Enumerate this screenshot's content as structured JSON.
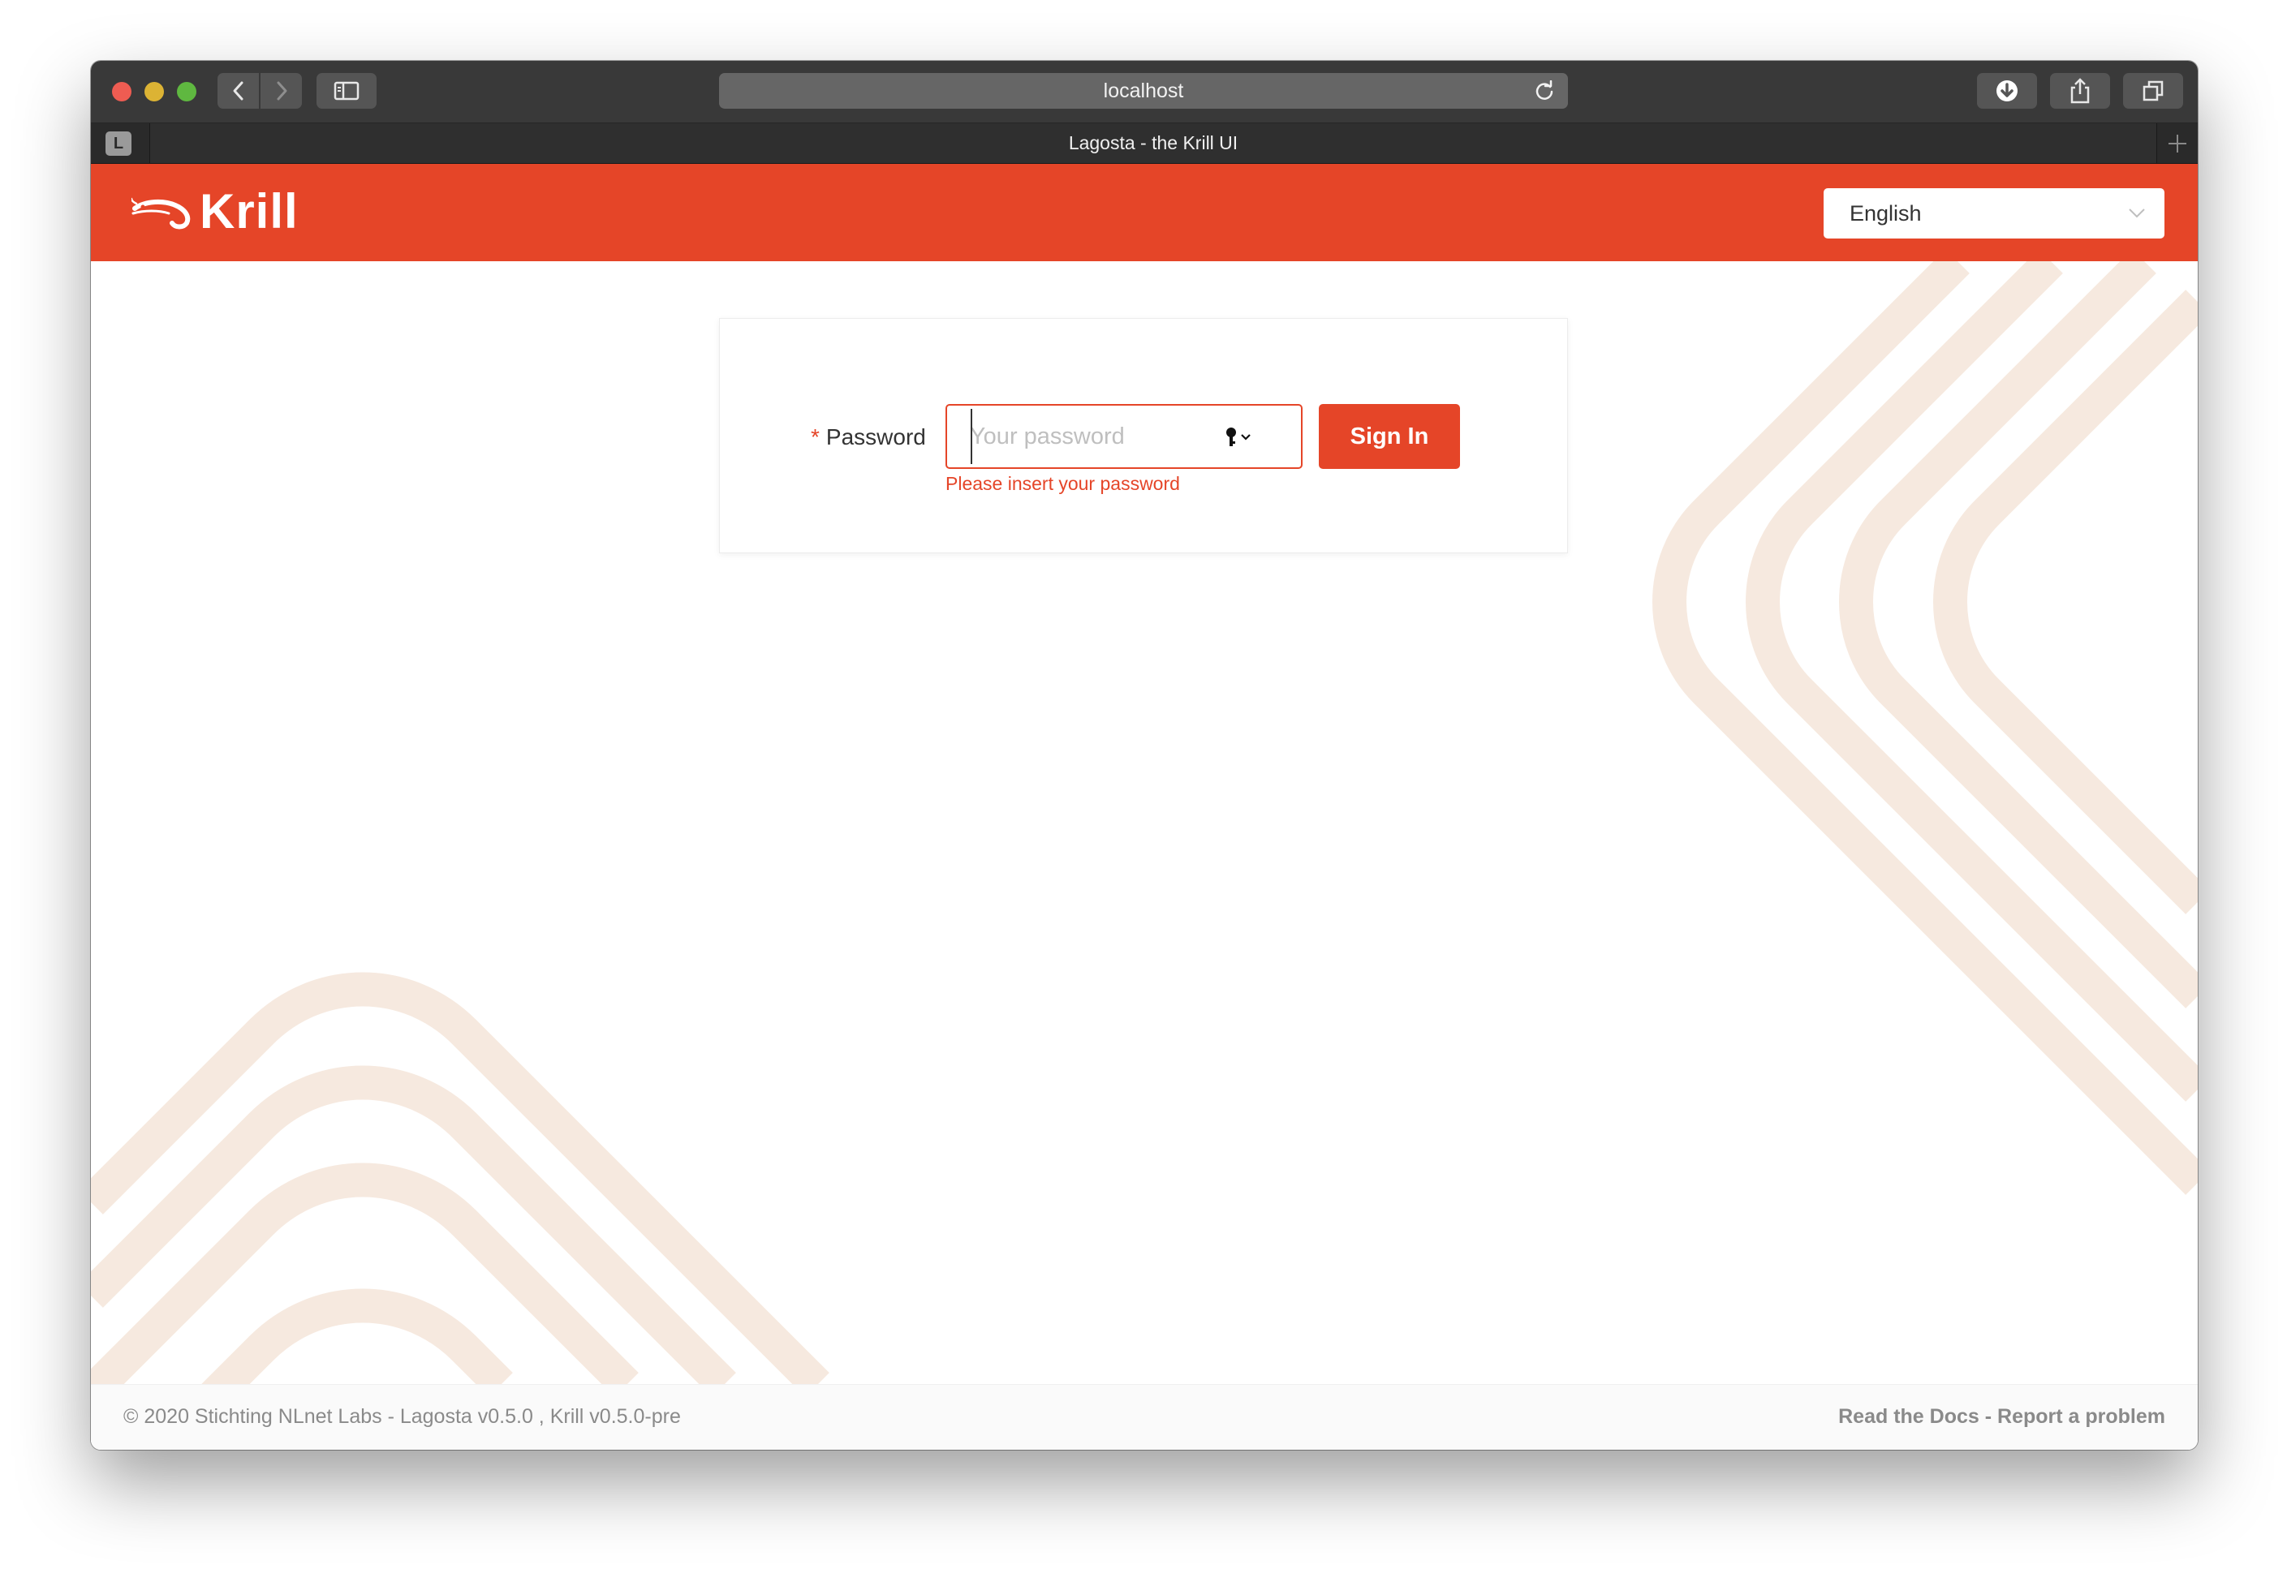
{
  "browser": {
    "url": "localhost",
    "tab_title": "Lagosta - the Krill UI",
    "tab_favicon_letter": "L"
  },
  "header": {
    "logo_text": "Krill",
    "language_select": {
      "value": "English"
    }
  },
  "login": {
    "password_required_mark": "*",
    "password_label": "Password",
    "password_placeholder": "Your password",
    "password_error": "Please insert your password",
    "submit_label": "Sign In"
  },
  "footer": {
    "copyright": "© 2020 Stichting NLnet Labs - Lagosta v0.5.0 , Krill v0.5.0-pre",
    "link_docs": "Read the Docs",
    "link_separator": " - ",
    "link_report": "Report a problem"
  },
  "colors": {
    "brand": "#e54528",
    "decor_stripe": "#f6e9df",
    "footer_text": "#8a8a8a"
  }
}
